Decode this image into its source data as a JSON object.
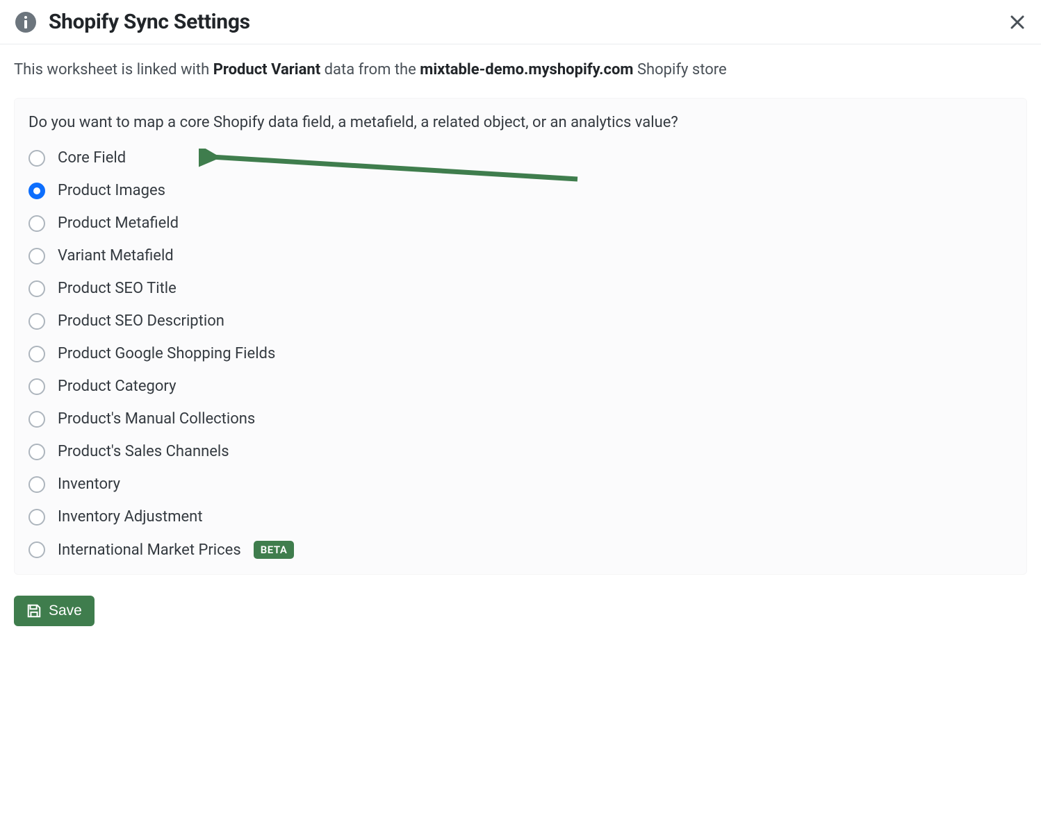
{
  "modal": {
    "title": "Shopify Sync Settings"
  },
  "link": {
    "prefix": "This worksheet is linked with ",
    "data_type": "Product Variant",
    "middle": " data from the ",
    "store": "mixtable-demo.myshopify.com",
    "suffix": " Shopify store"
  },
  "panel": {
    "question": "Do you want to map a core Shopify data field, a metafield, a related object, or an analytics value?",
    "options": [
      {
        "label": "Core Field",
        "selected": false
      },
      {
        "label": "Product Images",
        "selected": true
      },
      {
        "label": "Product Metafield",
        "selected": false
      },
      {
        "label": "Variant Metafield",
        "selected": false
      },
      {
        "label": "Product SEO Title",
        "selected": false
      },
      {
        "label": "Product SEO Description",
        "selected": false
      },
      {
        "label": "Product Google Shopping Fields",
        "selected": false
      },
      {
        "label": "Product Category",
        "selected": false
      },
      {
        "label": "Product's Manual Collections",
        "selected": false
      },
      {
        "label": "Product's Sales Channels",
        "selected": false
      },
      {
        "label": "Inventory",
        "selected": false
      },
      {
        "label": "Inventory Adjustment",
        "selected": false
      },
      {
        "label": "International Market Prices",
        "selected": false,
        "badge": "BETA"
      }
    ]
  },
  "footer": {
    "save_label": "Save"
  }
}
